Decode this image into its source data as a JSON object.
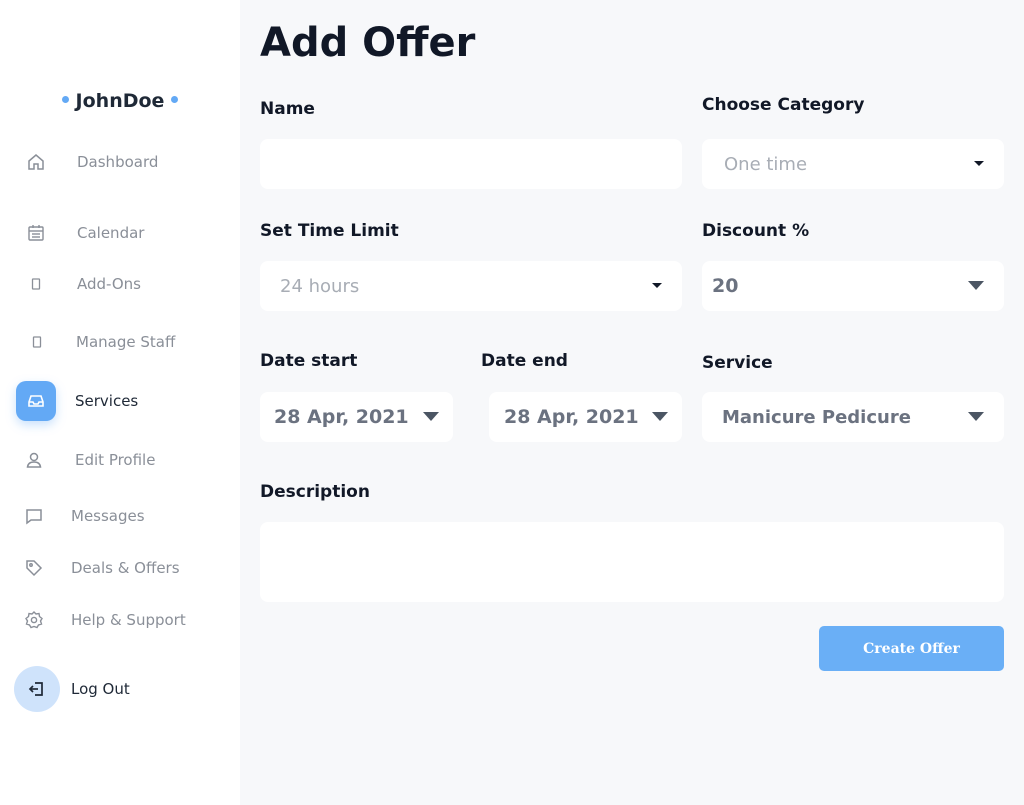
{
  "user": {
    "name": "JohnDoe"
  },
  "sidebar": {
    "items": [
      {
        "label": "Dashboard",
        "icon": "home-icon"
      },
      {
        "label": "Calendar",
        "icon": "calendar-icon"
      },
      {
        "label": "Add-Ons",
        "icon": "addons-icon"
      },
      {
        "label": "Manage Staff",
        "icon": "staff-icon"
      },
      {
        "label": "Services",
        "icon": "inbox-icon",
        "active": true
      },
      {
        "label": "Edit Profile",
        "icon": "user-icon"
      },
      {
        "label": "Messages",
        "icon": "message-icon"
      },
      {
        "label": "Deals & Offers",
        "icon": "tag-icon"
      },
      {
        "label": "Help & Support",
        "icon": "gear-icon"
      },
      {
        "label": "Log Out",
        "icon": "logout-icon"
      }
    ]
  },
  "form": {
    "title": "Add Offer",
    "name": {
      "label": "Name",
      "value": ""
    },
    "category": {
      "label": "Choose Category",
      "value": "One time"
    },
    "time_limit": {
      "label": "Set Time Limit",
      "value": "24 hours"
    },
    "discount": {
      "label": "Discount %",
      "value": "20"
    },
    "date_start": {
      "label": "Date start",
      "value": "28 Apr, 2021"
    },
    "date_end": {
      "label": "Date end",
      "value": "28 Apr, 2021"
    },
    "service": {
      "label": "Service",
      "value": "Manicure Pedicure"
    },
    "description": {
      "label": "Description",
      "value": ""
    },
    "submit_label": "Create Offer"
  },
  "colors": {
    "accent": "#63a9f5",
    "button": "#6aaff6",
    "logout_bg": "#cfe3fb",
    "page_bg": "#f7f8fa"
  }
}
